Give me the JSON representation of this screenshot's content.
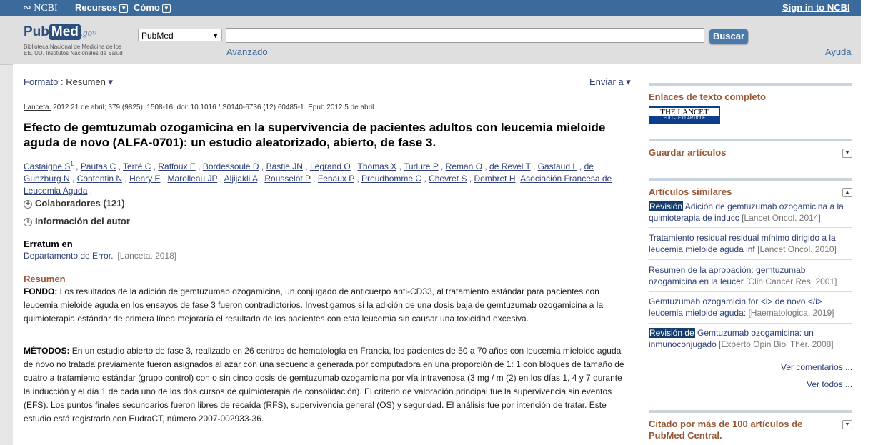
{
  "topbar": {
    "ncbi": "NCBI",
    "recursos": "Recursos",
    "como": "Cómo",
    "signin": "Sign in to NCBI"
  },
  "search": {
    "logo_pub": "Pub",
    "logo_med": "Med",
    "logo_gov": ".gov",
    "logo_sub": "Biblioteca Nacional de Medicina de los EE. UU. Institutos Nacionales de Salud",
    "db": "PubMed",
    "query": "",
    "button": "Buscar",
    "advanced": "Avanzado",
    "help": "Ayuda"
  },
  "main": {
    "format_label": "Formato",
    "format_value": "Resumen",
    "send": "Enviar a",
    "citation_journal": "Lanceta.",
    "citation_rest": " 2012 21 de abril; 379 (9825): 1508-16. doi: 10.1016 / S0140-6736 (12) 60485-1. Epub 2012 5 de abril.",
    "title": "Efecto de gemtuzumab ozogamicina en la supervivencia de pacientes adultos con leucemia mieloide aguda de novo (ALFA-0701): un estudio aleatorizado, abierto, de fase 3.",
    "authors": [
      "Castaigne S",
      "Pautas C",
      "Terré C",
      "Raffoux E",
      "Bordessoule D",
      "Bastie JN",
      "Legrand O",
      "Thomas X",
      "Turlure P",
      "Reman O",
      "de Revel T",
      "Gastaud L",
      "de Gunzburg N",
      "Contentin N",
      "Henry E",
      "Marolleau JP",
      "Aljijakli A",
      "Rousselot P",
      "Fenaux P",
      "Preudhomme C",
      "Chevret S",
      "Dombret H"
    ],
    "first_author_sup": "1",
    "group": "Asociación Francesa de Leucemia Aguda",
    "collaborators": "Colaboradores (121)",
    "author_info": "Información del autor",
    "erratum_heading": "Erratum en",
    "erratum_link": "Departamento de Error.",
    "erratum_source": "[Lanceta. 2018]",
    "abstract_heading": "Resumen",
    "background_label": "FONDO:",
    "background_text": " Los resultados de la adición de gemtuzumab ozogamicina, un conjugado de anticuerpo anti-CD33, al tratamiento estándar para pacientes con leucemia mieloide aguda en los ensayos de fase 3 fueron contradictorios. Investigamos si la adición de una dosis baja de gemtuzumab ozogamicina a la quimioterapia estándar de primera línea mejoraría el resultado de los pacientes con esta leucemia sin causar una toxicidad excesiva.",
    "methods_label": "MÉTODOS:",
    "methods_text": " En un estudio abierto de fase 3, realizado en 26 centros de hematología en Francia, los pacientes de 50 a 70 años con leucemia mieloide aguda de novo no tratada previamente fueron asignados al azar con una secuencia generada por computadora en una proporción de 1: 1 con bloques de tamaño de cuatro a tratamiento estándar (grupo control) con o sin cinco dosis de gemtuzumab ozogamicina por vía intravenosa (3 mg / m (2) en los días 1, 4 y 7 durante la inducción y el día 1 de cada uno de los dos cursos de quimioterapia de consolidación). El criterio de valoración principal fue la supervivencia sin eventos (EFS). Los puntos finales secundarios fueron libres de recaída (RFS), supervivencia general (OS) y seguridad. El análisis fue por intención de tratar. Este estudio está registrado con EudraCT, número 2007-002933-36."
  },
  "sidebar": {
    "fulltext_heading": "Enlaces de texto completo",
    "lancet_name": "THE LANCET",
    "lancet_sub": "FULL-TEXT ARTICLE",
    "save_heading": "Guardar artículos",
    "similar_heading": "Artículos similares",
    "similar": [
      {
        "badge": "Revisión",
        "text": " Adición de gemtuzumab ozogamicina a la quimioterapia de inducc",
        "source": "[Lancet Oncol. 2014]"
      },
      {
        "badge": "",
        "text": "Tratamiento residual residual mínimo dirigido a la leucemia mieloide aguda inf",
        "source": "[Lancet Oncol. 2010]"
      },
      {
        "badge": "",
        "text": "Resumen de la aprobación: gemtuzumab ozogamicina en la leucer",
        "source": "[Clin Cancer Res. 2001]"
      },
      {
        "badge": "",
        "text": "Gemtuzumab ozogamicin for <i> de novo </i> leucemia mieloide aguda:",
        "source": "[Haematologica. 2019]"
      },
      {
        "badge": "Revisión de",
        "text": " Gemtuzumab ozogamicina: un inmunoconjugado",
        "source": "[Experto Opin Biol Ther. 2008]"
      }
    ],
    "see_reviews": "Ver comentarios ...",
    "see_all": "Ver todos ...",
    "cited_heading": "Citado por más de 100 artículos de PubMed Central."
  }
}
